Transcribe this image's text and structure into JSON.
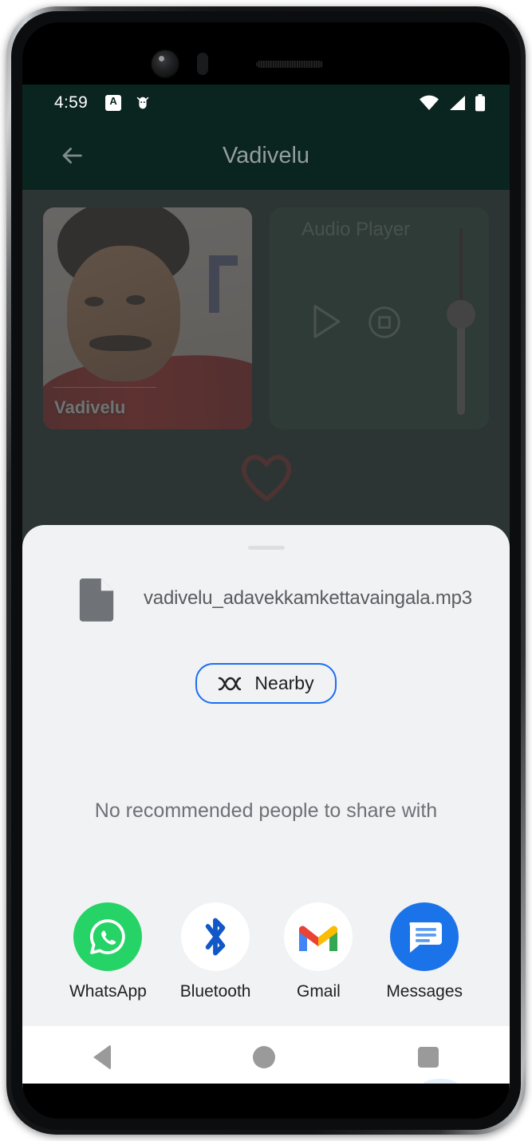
{
  "status_bar": {
    "clock": "4:59",
    "left_icons": [
      {
        "name": "caps-lock-indicator-icon",
        "glyph": "A"
      },
      {
        "name": "android-debug-bug-icon",
        "glyph": "bug"
      }
    ],
    "right_icons": [
      {
        "name": "wifi-icon",
        "label": "wifi-full"
      },
      {
        "name": "cellular-signal-icon",
        "label": "signal-full"
      },
      {
        "name": "battery-icon",
        "label": "battery-full"
      }
    ]
  },
  "app_bar": {
    "title": "Vadivelu",
    "back_icon": "arrow-left-icon"
  },
  "content": {
    "photo_card": {
      "caption": "Vadivelu"
    },
    "audio_player": {
      "title": "Audio Player",
      "play_icon": "play-triangle-icon",
      "stop_icon": "stop-square-circle-icon",
      "volume_value_percent": 48
    },
    "heart_icon": "heart-outline-icon",
    "heart_color": "#7a1f1c"
  },
  "share_sheet": {
    "file": {
      "icon": "document-file-icon",
      "name": "vadivelu_adavekkamkettavaingala.mp3"
    },
    "nearby_button": {
      "label": "Nearby",
      "icon": "nearby-share-icon",
      "accent_color": "#1b6ef3"
    },
    "empty_state": "No recommended people to share with",
    "apps": [
      {
        "label": "WhatsApp",
        "icon": "whatsapp-icon",
        "color": "#25D366"
      },
      {
        "label": "Bluetooth",
        "icon": "bluetooth-icon",
        "color": "#1057c7"
      },
      {
        "label": "Gmail",
        "icon": "gmail-icon",
        "color": "#EA4335"
      },
      {
        "label": "Messages",
        "icon": "messages-icon",
        "color": "#1a73e8"
      }
    ]
  },
  "nav_bar": {
    "back": "nav-back-triangle-icon",
    "home": "nav-home-circle-icon",
    "recents": "nav-recents-square-icon"
  }
}
